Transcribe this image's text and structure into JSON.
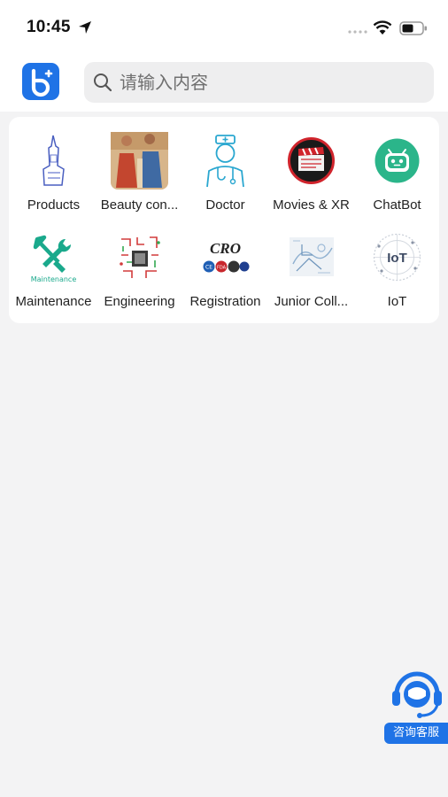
{
  "status_bar": {
    "time": "10:45",
    "icons": [
      "location-arrow-icon",
      "signal-dots-icon",
      "wifi-icon",
      "battery-icon"
    ]
  },
  "header": {
    "logo_icon": "app-logo-icon",
    "search": {
      "placeholder": "请输入内容",
      "value": ""
    }
  },
  "categories": [
    {
      "label": "Products",
      "icon": "chip-product-thumbnail"
    },
    {
      "label": "Beauty con...",
      "icon": "fresco-painting-thumbnail"
    },
    {
      "label": "Doctor",
      "icon": "doctor-thumbnail"
    },
    {
      "label": "Movies & XR",
      "icon": "clapperboard-thumbnail"
    },
    {
      "label": "ChatBot",
      "icon": "android-robot-thumbnail"
    },
    {
      "label": "Maintenance",
      "icon": "maintenance-tools-thumbnail",
      "thumb_caption": "Maintenance"
    },
    {
      "label": "Engineering",
      "icon": "circuit-board-thumbnail"
    },
    {
      "label": "Registration",
      "icon": "cro-certification-thumbnail",
      "thumb_caption": "CRO",
      "badges": [
        "CE",
        "FDA"
      ]
    },
    {
      "label": "Junior Coll...",
      "icon": "sketch-drawing-thumbnail"
    },
    {
      "label": "IoT",
      "icon": "iot-globe-thumbnail",
      "thumb_caption": "IoT"
    }
  ],
  "support": {
    "label": "咨询客服",
    "icon": "customer-service-headset-icon"
  },
  "colors": {
    "accent": "#1f73e6",
    "background": "#f3f3f4",
    "card": "#ffffff",
    "chatbot_green": "#2bb58a"
  }
}
